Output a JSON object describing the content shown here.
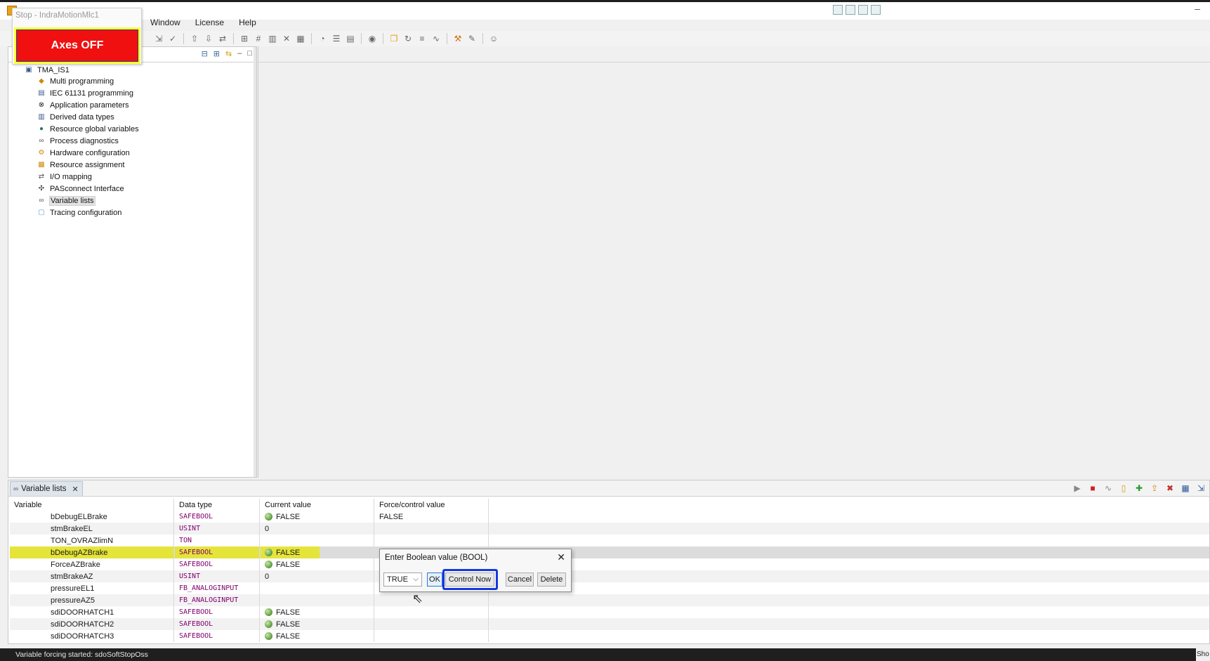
{
  "window": {
    "title": "",
    "menu": [
      "Window",
      "License",
      "Help"
    ]
  },
  "popup": {
    "title": "Stop - IndraMotionMlc1",
    "axes_label": "Axes OFF",
    "colors": {
      "button": "#f01010",
      "frame": "#ffff3c"
    }
  },
  "project_tree": {
    "root": "TMA_IS1",
    "items": [
      {
        "label": "Multi programming",
        "icon": "multi-programming-icon"
      },
      {
        "label": "IEC 61131 programming",
        "icon": "iec-programming-icon"
      },
      {
        "label": "Application parameters",
        "icon": "app-parameters-icon"
      },
      {
        "label": "Derived data types",
        "icon": "data-types-icon"
      },
      {
        "label": "Resource global variables",
        "icon": "globe-icon"
      },
      {
        "label": "Process diagnostics",
        "icon": "diagnostics-icon"
      },
      {
        "label": "Hardware configuration",
        "icon": "hardware-icon"
      },
      {
        "label": "Resource assignment",
        "icon": "resource-icon"
      },
      {
        "label": "I/O mapping",
        "icon": "io-mapping-icon"
      },
      {
        "label": "PASconnect Interface",
        "icon": "connect-icon"
      },
      {
        "label": "Variable lists",
        "icon": "variable-list-icon",
        "selected": true
      },
      {
        "label": "Tracing configuration",
        "icon": "tracing-icon"
      }
    ]
  },
  "variable_lists": {
    "tab_label": "Variable lists",
    "columns": [
      "Variable",
      "Data type",
      "Current value",
      "Force/control value"
    ],
    "rows": [
      {
        "variable": "bDebugELBrake",
        "type": "SAFEBOOL",
        "current": "FALSE",
        "led": true,
        "force": "FALSE"
      },
      {
        "variable": "stmBrakeEL",
        "type": "USINT",
        "current": "0",
        "led": false,
        "force": ""
      },
      {
        "variable": "TON_OVRAZlimN",
        "type": "TON",
        "current": "",
        "led": false,
        "force": ""
      },
      {
        "variable": "bDebugAZBrake",
        "type": "SAFEBOOL",
        "current": "FALSE",
        "led": true,
        "force": "",
        "highlight": true
      },
      {
        "variable": "ForceAZBrake",
        "type": "SAFEBOOL",
        "current": "FALSE",
        "led": true,
        "force": ""
      },
      {
        "variable": "stmBrakeAZ",
        "type": "USINT",
        "current": "0",
        "led": false,
        "force": ""
      },
      {
        "variable": "pressureEL1",
        "type": "FB_ANALOGINPUT",
        "current": "",
        "led": false,
        "force": ""
      },
      {
        "variable": "pressureAZ5",
        "type": "FB_ANALOGINPUT",
        "current": "",
        "led": false,
        "force": ""
      },
      {
        "variable": "sdiDOORHATCH1",
        "type": "SAFEBOOL",
        "current": "FALSE",
        "led": true,
        "force": ""
      },
      {
        "variable": "sdiDOORHATCH2",
        "type": "SAFEBOOL",
        "current": "FALSE",
        "led": true,
        "force": ""
      },
      {
        "variable": "sdiDOORHATCH3",
        "type": "SAFEBOOL",
        "current": "FALSE",
        "led": true,
        "force": ""
      }
    ]
  },
  "dialog": {
    "title": "Enter Boolean value (BOOL)",
    "selected_value": "TRUE",
    "ok_label": "OK",
    "control_now_label": "Control Now",
    "cancel_label": "Cancel",
    "delete_label": "Delete"
  },
  "status": {
    "message": "Variable forcing started: sdoSoftStopOss",
    "right_text": "Sho"
  }
}
